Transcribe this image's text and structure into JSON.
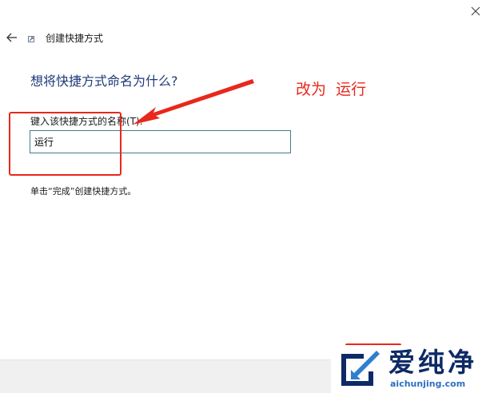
{
  "dialog": {
    "title": "创建快捷方式",
    "heading": "想将快捷方式命名为什么?",
    "name_label": "键入该快捷方式的名称(T):",
    "name_value": "运行",
    "hint": "单击“完成”创建快捷方式。"
  },
  "annotation": {
    "text": "改为  运行",
    "color": "#e8281c"
  },
  "watermark": {
    "name": "爱纯净",
    "url": "aichunjing.com"
  },
  "icons": {
    "close": "close-icon",
    "back": "back-arrow-icon",
    "wizard": "shortcut-icon",
    "logo": "aichunjing-logo-icon"
  }
}
